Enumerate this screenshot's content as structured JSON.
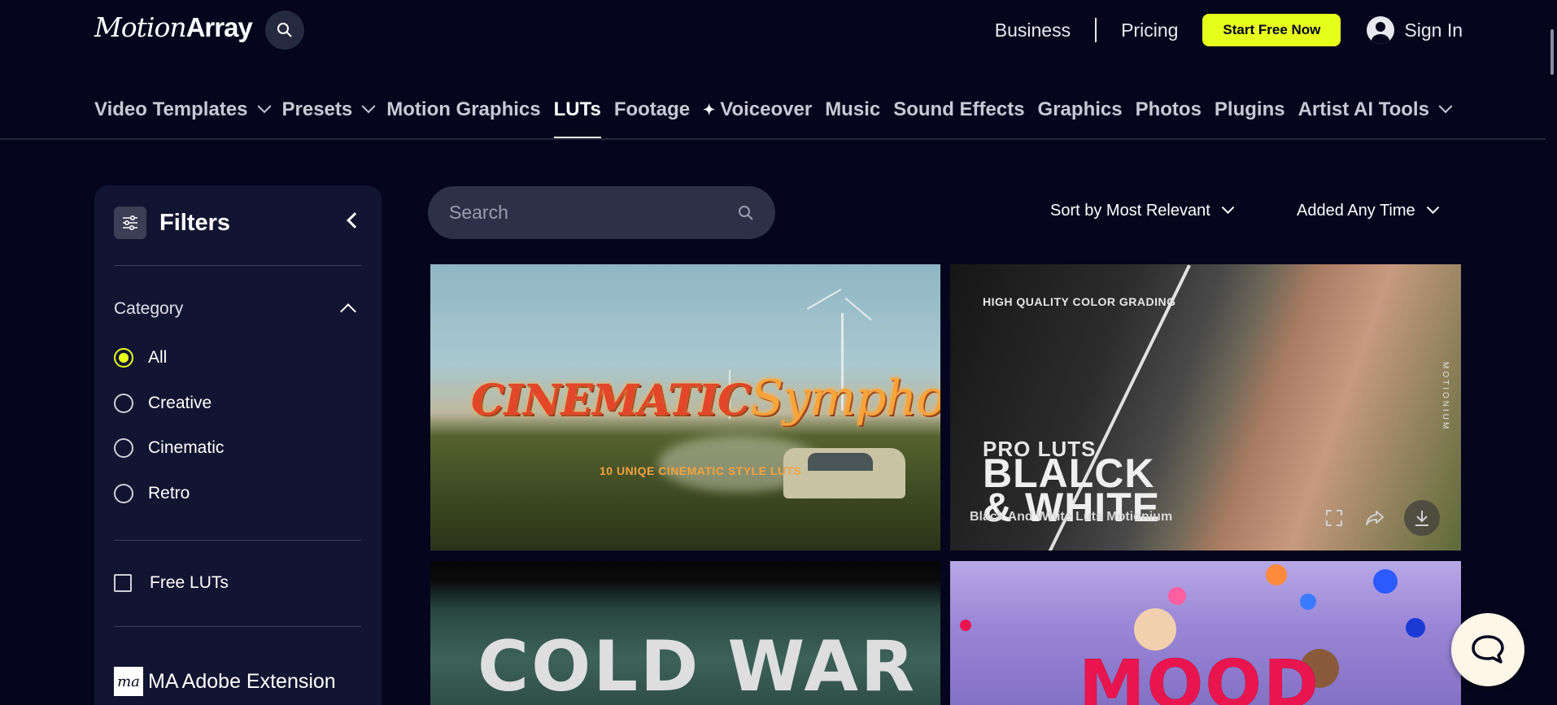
{
  "header": {
    "logo_light": "Motion",
    "logo_bold": "Array",
    "business": "Business",
    "pricing": "Pricing",
    "cta": "Start Free Now",
    "signin": "Sign In"
  },
  "nav": {
    "items": [
      {
        "label": "Video Templates",
        "dropdown": true
      },
      {
        "label": "Presets",
        "dropdown": true
      },
      {
        "label": "Motion Graphics"
      },
      {
        "label": "LUTs",
        "active": true
      },
      {
        "label": "Footage"
      },
      {
        "label": "Voiceover",
        "icon": "sparkle-icon"
      },
      {
        "label": "Music"
      },
      {
        "label": "Sound Effects"
      },
      {
        "label": "Graphics"
      },
      {
        "label": "Photos"
      },
      {
        "label": "Plugins"
      },
      {
        "label": "Artist AI Tools",
        "dropdown": true
      }
    ]
  },
  "filters": {
    "title": "Filters",
    "category_title": "Category",
    "options": [
      "All",
      "Creative",
      "Cinematic",
      "Retro"
    ],
    "selected": "All",
    "free_label": "Free LUTs",
    "extension_logo": "ma",
    "extension_label": "MA Adobe Extension"
  },
  "toolbar": {
    "search_placeholder": "Search",
    "sort_label": "Sort by Most Relevant",
    "time_label": "Added Any Time"
  },
  "cards": [
    {
      "title_a": "CINEMATIC",
      "title_b": "Symphony",
      "subtitle": "10 UNIQE CINEMATIC STYLE LUTS"
    },
    {
      "tag": "HIGH QUALITY COLOR GRADING",
      "pro": "PRO LUTS",
      "big_1": "BLALCK",
      "big_2": "& WHITE",
      "caption": "Black And White Luts  Motionium",
      "vertical": "MOTIONIUM"
    },
    {
      "title": "COLD WAR"
    },
    {
      "title": "MOOD"
    }
  ],
  "colors": {
    "background": "#05051e",
    "accent": "#e6ff1a",
    "sidebar": "#111531"
  }
}
